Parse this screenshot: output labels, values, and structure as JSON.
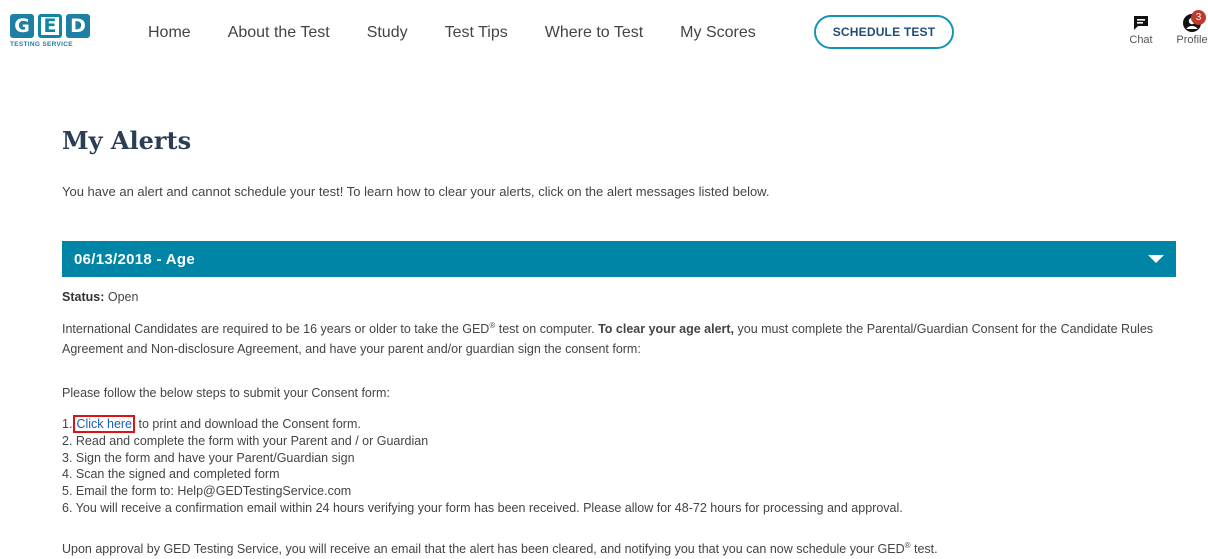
{
  "logo": {
    "letters": [
      "G",
      "E",
      "D"
    ],
    "tagline": "TESTING SERVICE"
  },
  "nav": {
    "items": [
      "Home",
      "About the Test",
      "Study",
      "Test Tips",
      "Where to Test",
      "My Scores"
    ],
    "schedule_label": "SCHEDULE TEST"
  },
  "utility": {
    "chat_label": "Chat",
    "profile_label": "Profile",
    "profile_badge": "3",
    "chat_icon": "chat-bubble-icon",
    "profile_icon": "user-icon"
  },
  "page": {
    "title": "My Alerts",
    "intro": "You have an alert and cannot schedule your test! To learn how to clear your alerts, click on the alert messages listed below."
  },
  "alert": {
    "header": "06/13/2018 - Age",
    "status_label": "Status:",
    "status_value": "Open",
    "desc_part1": "International Candidates are required to be 16 years or older to take the GED",
    "desc_part2": " test on computer. ",
    "desc_bold": "To clear your age alert,",
    "desc_part3": " you must complete the Parental/Guardian Consent for the Candidate Rules Agreement and Non-disclosure Agreement, and have your parent and/or guardian sign the consent form:",
    "registered_mark": "®",
    "steps_intro": "Please follow the below steps to submit your Consent form:",
    "step1_num": "1.",
    "step1_link": "Click here",
    "step1_rest": " to print and download the Consent form.",
    "steps_rest": [
      "2. Read and complete the form with your Parent and / or Guardian",
      "3. Sign the form and have your Parent/Guardian sign",
      "4. Scan the signed and completed form",
      "5. Email the form to: Help@GEDTestingService.com",
      "6. You will receive a confirmation email within 24 hours verifying your form has been received. Please allow for 48-72 hours for processing and approval."
    ],
    "approval_text": "Upon approval by GED Testing Service, you will receive an email that the alert has been cleared, and notifying you that you can now schedule your GED",
    "approval_end": " test."
  },
  "colors": {
    "accent": "#0085a6",
    "title": "#2b3e55",
    "link": "#1a5fb4",
    "highlight_box": "#d9141a"
  }
}
